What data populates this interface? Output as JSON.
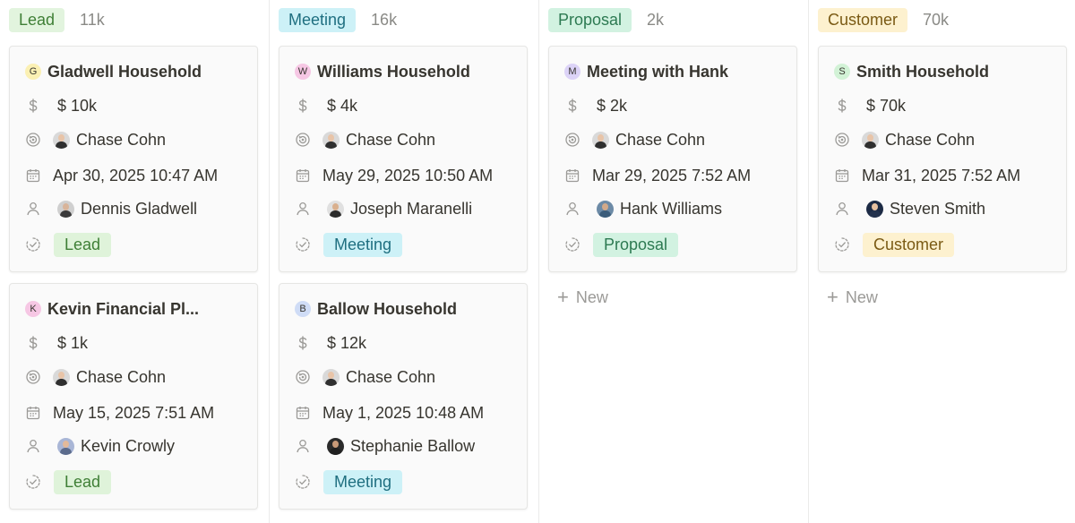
{
  "columns": [
    {
      "stage": "Lead",
      "count": "11k",
      "pill_bg": "#e2f4de",
      "pill_fg": "#3f7f36",
      "cards": [
        {
          "initial": "G",
          "badge_color": "#fbf0b3",
          "title": "Gladwell Household",
          "amount": "$ 10k",
          "owner": "Chase Cohn",
          "date": "Apr 30, 2025 10:47 AM",
          "contact": "Dennis Gladwell",
          "status": "Lead",
          "status_bg": "#dff3da",
          "status_fg": "#3f7f36"
        },
        {
          "initial": "K",
          "badge_color": "#f6c7e4",
          "title": "Kevin Financial Pl...",
          "amount": "$ 1k",
          "owner": "Chase Cohn",
          "date": "May 15, 2025 7:51 AM",
          "contact": "Kevin Crowly",
          "status": "Lead",
          "status_bg": "#dff3da",
          "status_fg": "#3f7f36"
        }
      ],
      "new_label": ""
    },
    {
      "stage": "Meeting",
      "count": "16k",
      "pill_bg": "#cdf1f7",
      "pill_fg": "#1f6f80",
      "cards": [
        {
          "initial": "W",
          "badge_color": "#f6c7e4",
          "title": "Williams Household",
          "amount": "$ 4k",
          "owner": "Chase Cohn",
          "date": "May 29, 2025 10:50 AM",
          "contact": "Joseph Maranelli",
          "status": "Meeting",
          "status_bg": "#cdf1f7",
          "status_fg": "#1f6f80"
        },
        {
          "initial": "B",
          "badge_color": "#cfdcf6",
          "title": "Ballow Household",
          "amount": "$ 12k",
          "owner": "Chase Cohn",
          "date": "May 1, 2025 10:48 AM",
          "contact": "Stephanie Ballow",
          "status": "Meeting",
          "status_bg": "#cdf1f7",
          "status_fg": "#1f6f80"
        }
      ],
      "new_label": ""
    },
    {
      "stage": "Proposal",
      "count": "2k",
      "pill_bg": "#d2f2e1",
      "pill_fg": "#2d7a52",
      "cards": [
        {
          "initial": "M",
          "badge_color": "#dcd3f7",
          "title": "Meeting with Hank",
          "amount": "$ 2k",
          "owner": "Chase Cohn",
          "date": "Mar 29, 2025 7:52 AM",
          "contact": "Hank Williams",
          "status": "Proposal",
          "status_bg": "#d2f2e1",
          "status_fg": "#2d7a52"
        }
      ],
      "new_label": "New"
    },
    {
      "stage": "Customer",
      "count": "70k",
      "pill_bg": "#fdf1cf",
      "pill_fg": "#7a5a14",
      "cards": [
        {
          "initial": "S",
          "badge_color": "#d2f2d6",
          "title": "Smith Household",
          "amount": "$ 70k",
          "owner": "Chase Cohn",
          "date": "Mar 31, 2025 7:52 AM",
          "contact": "Steven Smith",
          "status": "Customer",
          "status_bg": "#fdf1cf",
          "status_fg": "#7a5a14"
        }
      ],
      "new_label": "New"
    }
  ],
  "icons": {
    "amount": "dollar-icon",
    "owner": "owner-icon",
    "date": "calendar-icon",
    "contact": "person-icon",
    "status": "status-check-icon",
    "new": "plus-icon"
  },
  "avatar_colors": {
    "owner": {
      "skin": "#e8c4a8",
      "shirt": "#2f2f2f",
      "bg": "#d9d9d9"
    },
    "contacts": {
      "Dennis Gladwell": {
        "skin": "#d8b49a",
        "shirt": "#3a3a3a",
        "bg": "#cfcfcf"
      },
      "Kevin Crowly": {
        "skin": "#e2b99a",
        "shirt": "#5b6b8c",
        "bg": "#a9b6d6"
      },
      "Joseph Maranelli": {
        "skin": "#d9b08e",
        "shirt": "#2b2b2b",
        "bg": "#e0e0e0"
      },
      "Stephanie Ballow": {
        "skin": "#c99a78",
        "shirt": "#1f1f1f",
        "bg": "#2a2a2a"
      },
      "Hank Williams": {
        "skin": "#d2a989",
        "shirt": "#3b5c7a",
        "bg": "#6c8aa6"
      },
      "Steven Smith": {
        "skin": "#e6c0a0",
        "shirt": "#23324d",
        "bg": "#1c2a44"
      }
    }
  }
}
